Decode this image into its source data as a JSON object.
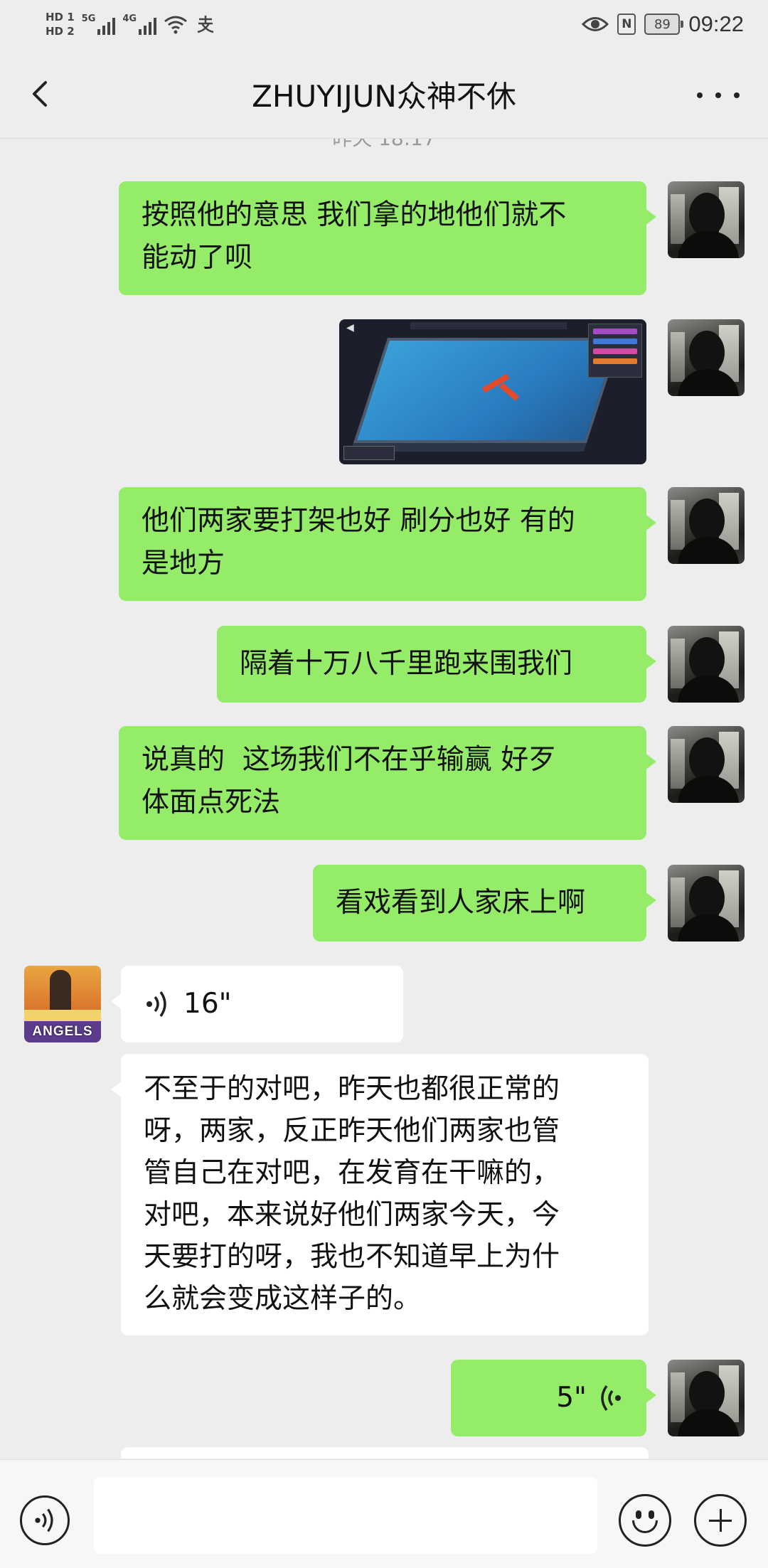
{
  "status_bar": {
    "hd1": "HD 1",
    "hd2": "HD 2",
    "net1": "5G",
    "net2": "4G",
    "battery": "89",
    "time": "09:22"
  },
  "nav": {
    "title": "ZHUYIJUN众神不休",
    "back_icon": "chevron-left-icon",
    "more_icon": "more-dots-icon"
  },
  "messages": [
    {
      "side": "me",
      "type": "text",
      "lines": [
        "按照他的意思 我们拿的地他们就不",
        "能动了呗"
      ]
    },
    {
      "side": "me",
      "type": "image",
      "content": "game-map-screenshot"
    },
    {
      "side": "me",
      "type": "text",
      "lines": [
        "他们两家要打架也好 刷分也好 有的",
        "是地方"
      ]
    },
    {
      "side": "me",
      "type": "text",
      "lines": [
        "隔着十万八千里跑来围我们"
      ]
    },
    {
      "side": "me",
      "type": "text",
      "lines": [
        "说真的  这场我们不在乎输赢 好歹",
        "体面点死法"
      ]
    },
    {
      "side": "me",
      "type": "text",
      "lines": [
        "看戏看到人家床上啊"
      ]
    },
    {
      "side": "other",
      "type": "voice",
      "duration": "16\""
    },
    {
      "side": "other",
      "type": "text",
      "lines": [
        "不至于的对吧，昨天也都很正常的",
        "呀，两家，反正昨天他们两家也管",
        "管自己在对吧，在发育在干嘛的，",
        "对吧，本来说好他们两家今天，今",
        "天要打的呀，我也不知道早上为什",
        "么就会变成这样子的。"
      ]
    },
    {
      "side": "me",
      "type": "voice",
      "duration": "5\""
    }
  ],
  "other_avatar_text": "ANGELS",
  "colors": {
    "background": "#ededed",
    "my_bubble": "#95ec69",
    "other_bubble": "#ffffff"
  },
  "bottom_bar": {
    "voice_icon": "voice-input-icon",
    "emoji_icon": "emoji-icon",
    "plus_icon": "plus-icon",
    "input_value": ""
  }
}
